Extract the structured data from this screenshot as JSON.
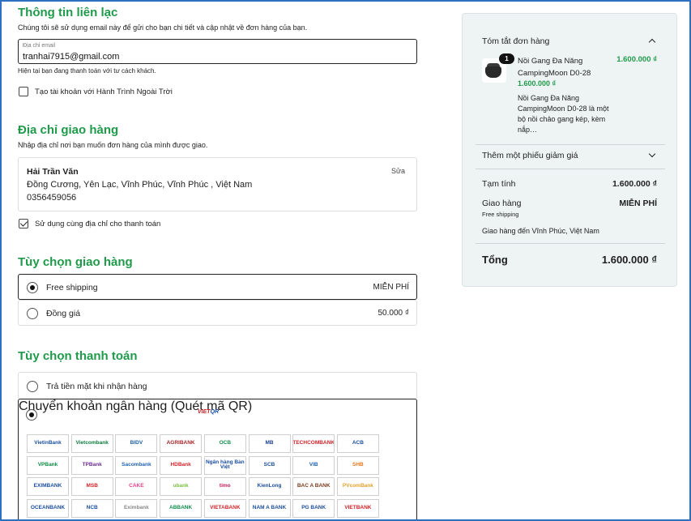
{
  "contact": {
    "title": "Thông tin liên lạc",
    "description": "Chúng tôi sẽ sử dụng email này để gửi cho bạn chi tiết và cập nhật về đơn hàng của bạn.",
    "email_label": "Địa chỉ email",
    "email_value": "tranhai7915@gmail.com",
    "guest_note": "Hiện tại bạn đang thanh toán với tư cách khách.",
    "create_account_label": "Tạo tài khoản với Hành Trình Ngoài Trời"
  },
  "shipping_address": {
    "title": "Địa chỉ giao hàng",
    "description": "Nhập địa chỉ nơi bạn muốn đơn hàng của mình được giao.",
    "name": "Hải Trần Văn",
    "address": "Đồng Cương, Yên Lạc, Vĩnh Phúc, Vĩnh Phúc , Việt Nam",
    "phone": "0356459056",
    "edit_label": "Sửa",
    "same_billing_label": "Sử dụng cùng địa chỉ cho thanh toán"
  },
  "shipping_options": {
    "title": "Tùy chọn giao hàng",
    "items": [
      {
        "label": "Free shipping",
        "price": "MIỄN PHÍ",
        "selected": true
      },
      {
        "label": "Đồng giá",
        "price": "50.000 ₫",
        "selected": false
      }
    ]
  },
  "payment_options": {
    "title": "Tùy chọn thanh toán",
    "cod_label": "Trả tiền mặt khi nhận hàng",
    "bank_label": "Chuyển khoản ngân hàng (Quét mã QR)",
    "vietqr_viet": "VIET",
    "vietqr_qr": "QR",
    "banks": [
      {
        "name": "VietinBank",
        "color": "#1a4f9c"
      },
      {
        "name": "Vietcombank",
        "color": "#0a7a3d"
      },
      {
        "name": "BIDV",
        "color": "#1b5fa8"
      },
      {
        "name": "AGRIBANK",
        "color": "#a3262a"
      },
      {
        "name": "OCB",
        "color": "#0f8f4b"
      },
      {
        "name": "MB",
        "color": "#1b3f8f"
      },
      {
        "name": "TECHCOMBANK",
        "color": "#d3232a"
      },
      {
        "name": "ACB",
        "color": "#1c4fa0"
      },
      {
        "name": "VPBank",
        "color": "#0d8c44"
      },
      {
        "name": "TPBank",
        "color": "#6b2c91"
      },
      {
        "name": "Sacombank",
        "color": "#1f63b4"
      },
      {
        "name": "HDBank",
        "color": "#d3232a"
      },
      {
        "name": "Ngân hàng Bản Việt",
        "color": "#1c4fa0"
      },
      {
        "name": "SCB",
        "color": "#1c4fa0"
      },
      {
        "name": "VIB",
        "color": "#1d5fae"
      },
      {
        "name": "SHB",
        "color": "#e67a1e"
      },
      {
        "name": "EXIMBANK",
        "color": "#1c4fa0"
      },
      {
        "name": "MSB",
        "color": "#d3232a"
      },
      {
        "name": "CAKE",
        "color": "#e83e8c"
      },
      {
        "name": "ubank",
        "color": "#7ac143"
      },
      {
        "name": "timo",
        "color": "#c2185b"
      },
      {
        "name": "KienLong",
        "color": "#1c4fa0"
      },
      {
        "name": "BAC A BANK",
        "color": "#7a3a1c"
      },
      {
        "name": "PVcomBank",
        "color": "#e3a12b"
      },
      {
        "name": "OCEANBANK",
        "color": "#1c4fa0"
      },
      {
        "name": "NCB",
        "color": "#1c4fa0"
      },
      {
        "name": "Eximbank",
        "color": "#888888"
      },
      {
        "name": "ABBANK",
        "color": "#0f8f4b"
      },
      {
        "name": "VIETABANK",
        "color": "#d3232a"
      },
      {
        "name": "NAM A BANK",
        "color": "#1c4fa0"
      },
      {
        "name": "PG BANK",
        "color": "#1c4fa0"
      },
      {
        "name": "VIETBANK",
        "color": "#d3232a"
      }
    ]
  },
  "order_summary": {
    "title": "Tóm tắt đơn hàng",
    "item": {
      "quantity": "1",
      "name": "Nồi Gang Đa Năng CampingMoon D0-28",
      "price": "1.600.000 ₫",
      "unit_price": "1.600.000 ₫",
      "description": "Nồi Gang Đa Năng CampingMoon D0-28 là một bộ nồi chảo gang kép, kèm nắp…"
    },
    "coupon_label": "Thêm một phiếu giảm giá",
    "subtotal_label": "Tạm tính",
    "subtotal_value": "1.600.000 ₫",
    "shipping_label": "Giao hàng",
    "shipping_value": "MIỄN PHÍ",
    "shipping_method": "Free shipping",
    "shipping_destination": "Giao hàng đến Vĩnh Phúc, Việt Nam",
    "total_label": "Tổng",
    "total_value": "1.600.000 ₫"
  }
}
